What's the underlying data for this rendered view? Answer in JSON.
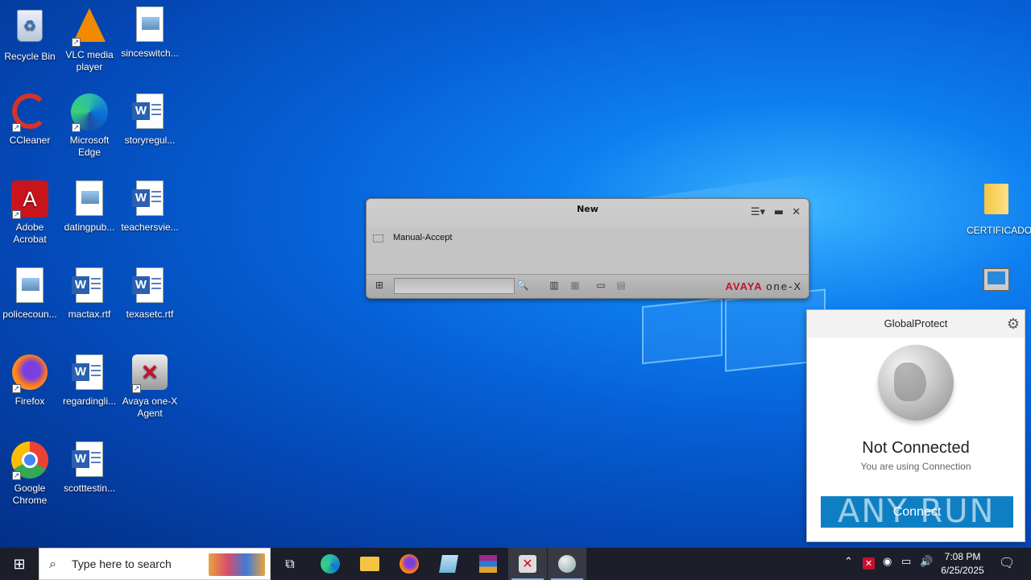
{
  "desktop": {
    "icons": [
      {
        "label": "Recycle Bin",
        "icon": "recycle-bin-icon"
      },
      {
        "label": "VLC media player",
        "icon": "vlc-icon"
      },
      {
        "label": "sinceswitch...",
        "icon": "image-file-icon"
      },
      {
        "label": "CCleaner",
        "icon": "ccleaner-icon"
      },
      {
        "label": "Microsoft Edge",
        "icon": "edge-icon"
      },
      {
        "label": "storyregul...",
        "icon": "word-doc-icon"
      },
      {
        "label": "Adobe Acrobat",
        "icon": "acrobat-icon"
      },
      {
        "label": "datingpub...",
        "icon": "image-file-icon"
      },
      {
        "label": "teachersvie...",
        "icon": "word-doc-icon"
      },
      {
        "label": "policecoun...",
        "icon": "image-file-icon"
      },
      {
        "label": "mactax.rtf",
        "icon": "word-doc-icon"
      },
      {
        "label": "texasetc.rtf",
        "icon": "word-doc-icon"
      },
      {
        "label": "Firefox",
        "icon": "firefox-icon"
      },
      {
        "label": "regardingli...",
        "icon": "word-doc-icon"
      },
      {
        "label": "Avaya one-X Agent",
        "icon": "avaya-icon"
      },
      {
        "label": "Google Chrome",
        "icon": "chrome-icon"
      },
      {
        "label": "scotttestin...",
        "icon": "word-doc-icon"
      },
      {
        "label": "CERTIFICADO",
        "icon": "folder-icon"
      }
    ]
  },
  "avaya": {
    "title": "New",
    "item_label": "Manual-Accept",
    "brand_left": "AVAYA",
    "brand_right": "one-X"
  },
  "globalprotect": {
    "title": "GlobalProtect",
    "status": "Not Connected",
    "subtitle": "You are using Connection",
    "connect_label": "Connect"
  },
  "watermark": "ANY RUN",
  "taskbar": {
    "search_placeholder": "Type here to search",
    "time": "7:08 PM",
    "date": "6/25/2025"
  },
  "colors": {
    "desktop_blue": "#0660d6",
    "taskbar": "#1c1e2a",
    "gp_button": "#0f7fc4",
    "avaya_red": "#c8102e"
  }
}
